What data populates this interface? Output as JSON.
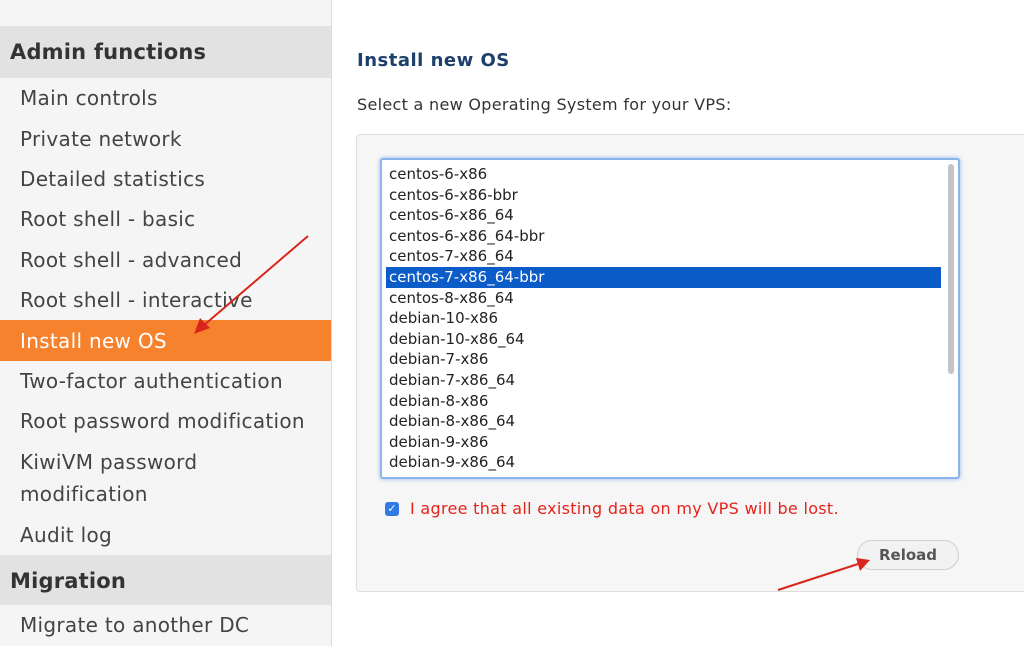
{
  "sidebar": {
    "sections": [
      {
        "title": "Admin functions",
        "items": [
          {
            "label": "Main controls"
          },
          {
            "label": "Private network"
          },
          {
            "label": "Detailed statistics"
          },
          {
            "label": "Root shell - basic"
          },
          {
            "label": "Root shell - advanced"
          },
          {
            "label": "Root shell - interactive"
          },
          {
            "label": "Install new OS",
            "active": true
          },
          {
            "label": "Two-factor authentication"
          },
          {
            "label": "Root password modification"
          },
          {
            "label": "KiwiVM password modification"
          },
          {
            "label": "Audit log"
          }
        ]
      },
      {
        "title": "Migration",
        "items": [
          {
            "label": "Migrate to another DC"
          }
        ]
      }
    ]
  },
  "main": {
    "title": "Install new OS",
    "subtitle": "Select a new Operating System for your VPS:",
    "os_options": [
      "centos-6-x86",
      "centos-6-x86-bbr",
      "centos-6-x86_64",
      "centos-6-x86_64-bbr",
      "centos-7-x86_64",
      "centos-7-x86_64-bbr",
      "centos-8-x86_64",
      "debian-10-x86",
      "debian-10-x86_64",
      "debian-7-x86",
      "debian-7-x86_64",
      "debian-8-x86",
      "debian-8-x86_64",
      "debian-9-x86",
      "debian-9-x86_64"
    ],
    "selected_os": "centos-7-x86_64-bbr",
    "agree_checked": true,
    "agree_label": "I agree that all existing data on my VPS will be lost.",
    "reload_label": "Reload"
  },
  "colors": {
    "active_item": "#f7822e",
    "section_header_bg": "#e2e2e2",
    "title": "#1d3f6b",
    "selected_option": "#0b5bc9",
    "warning_text": "#e5231b",
    "annotation_arrow": "#d9261c"
  },
  "icons": {
    "checkbox": "checkmark-icon",
    "annotation": "red-arrow-icon"
  }
}
